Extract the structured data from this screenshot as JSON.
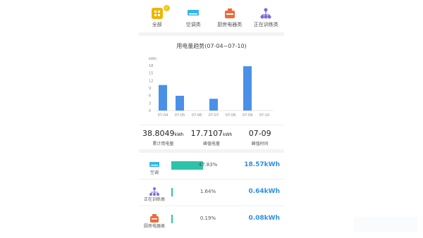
{
  "tabs": [
    {
      "label": "全部",
      "icon": "grid-icon",
      "color": "#f0b400",
      "active": true
    },
    {
      "label": "空调类",
      "icon": "air-conditioner-icon",
      "color": "#35b6e8"
    },
    {
      "label": "厨房电器类",
      "icon": "kitchen-appliance-icon",
      "color": "#f06a3a"
    },
    {
      "label": "正在训练类",
      "icon": "training-network-icon",
      "color": "#7b6ad8"
    }
  ],
  "chart_data": {
    "type": "bar",
    "title": "用电量趋势(07-04~07-10)",
    "ylabel": "kWh",
    "categories": [
      "07-04",
      "07-05",
      "07-06",
      "07-07",
      "07-08",
      "07-09",
      "07-10"
    ],
    "values": [
      10.2,
      5.9,
      0,
      4.7,
      0,
      17.7,
      0
    ],
    "ylim": [
      0,
      18
    ],
    "yticks": [
      0,
      3,
      6,
      9,
      12,
      15,
      18
    ],
    "color": "#4a90e8"
  },
  "stats": [
    {
      "value": "38.8049",
      "unit": "kWh",
      "label": "累计用电量"
    },
    {
      "value": "17.7107",
      "unit": "kWh",
      "label": "峰值电量"
    },
    {
      "value": "07-09",
      "unit": "",
      "label": "峰值时间"
    }
  ],
  "breakdown": [
    {
      "label": "空调",
      "icon": "air-conditioner-icon",
      "percent_text": "47.83%",
      "percent": 47.83,
      "kwh": "18.57kWh"
    },
    {
      "label": "正在训练类",
      "icon": "training-network-icon",
      "percent_text": "1.64%",
      "percent": 1.64,
      "kwh": "0.64kWh"
    },
    {
      "label": "厨房电器类",
      "icon": "kitchen-appliance-icon",
      "percent_text": "0.19%",
      "percent": 0.19,
      "kwh": "0.08kWh"
    }
  ]
}
